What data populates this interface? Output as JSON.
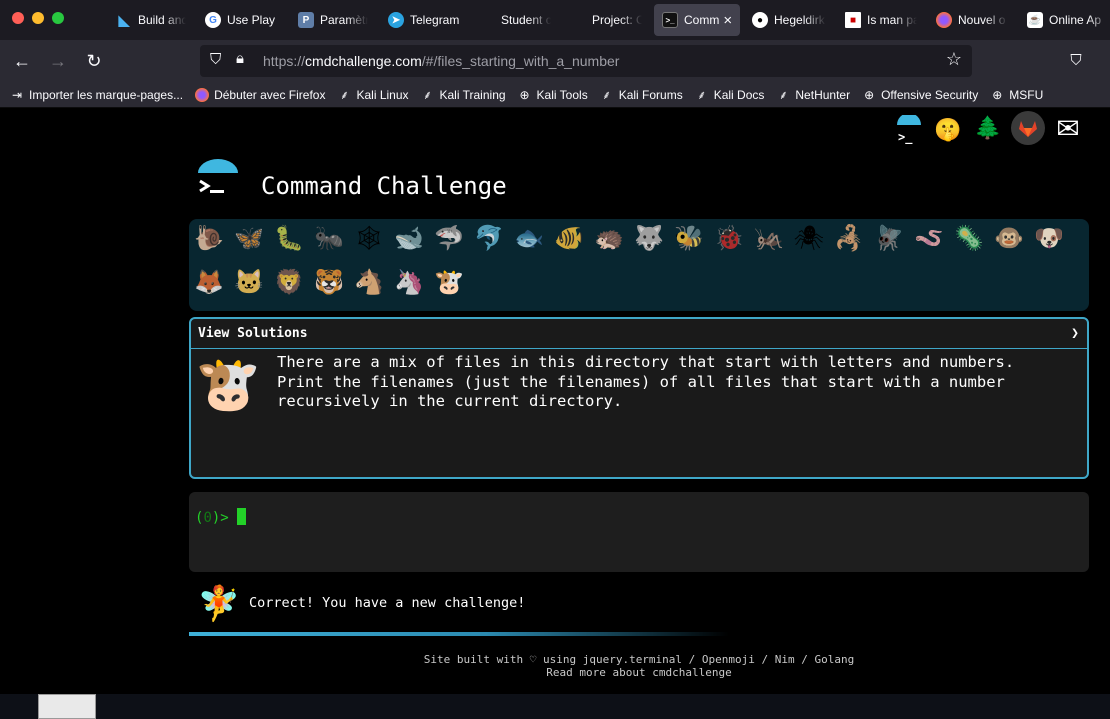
{
  "browser": {
    "tabs": [
      {
        "label": "Build and",
        "icon": "flutter-icon",
        "color": "#4ab2f1"
      },
      {
        "label": "Use Play",
        "icon": "google-icon",
        "color": "#ffffff"
      },
      {
        "label": "Paramètr",
        "icon": "settings-doc-icon",
        "color": "#7a9bd1"
      },
      {
        "label": "Telegram",
        "icon": "telegram-icon",
        "color": "#2aa3e0"
      },
      {
        "label": "Student c",
        "icon": "blank-icon",
        "color": "#1c1b22"
      },
      {
        "label": "Project: C",
        "icon": "blank-icon",
        "color": "#1c1b22"
      },
      {
        "label": "Comm",
        "icon": "terminal-icon",
        "color": "#111111"
      },
      {
        "label": "Hegeldirk",
        "icon": "github-icon",
        "color": "#ffffff"
      },
      {
        "label": "Is man pa",
        "icon": "doc-icon",
        "color": "#ffffff"
      },
      {
        "label": "Nouvel o",
        "icon": "firefox-icon",
        "color": "#ff7139"
      },
      {
        "label": "Online Ap",
        "icon": "java-icon",
        "color": "#ffffff"
      }
    ],
    "active_tab_close": "×",
    "url_prefix": "https://",
    "url_host": "cmdchallenge.com",
    "url_path": "/#/files_starting_with_a_number",
    "bookmarks": [
      {
        "label": "Importer les marque-pages...",
        "icon": "import-icon"
      },
      {
        "label": "Débuter avec Firefox",
        "icon": "firefox-icon"
      },
      {
        "label": "Kali Linux",
        "icon": "kali-icon"
      },
      {
        "label": "Kali Training",
        "icon": "kali-icon"
      },
      {
        "label": "Kali Tools",
        "icon": "globe-icon"
      },
      {
        "label": "Kali Forums",
        "icon": "kali-icon"
      },
      {
        "label": "Kali Docs",
        "icon": "kali-icon"
      },
      {
        "label": "NetHunter",
        "icon": "kali-icon"
      },
      {
        "label": "Offensive Security",
        "icon": "globe-icon"
      },
      {
        "label": "MSFU",
        "icon": "globe-icon"
      }
    ]
  },
  "site": {
    "title": "Command Challenge",
    "header_icons": [
      {
        "name": "cmd-logo-icon",
        "glyph": ">_"
      },
      {
        "name": "shushing-face-icon",
        "glyph": "🤫"
      },
      {
        "name": "evergreen-tree-icon",
        "glyph": "🌲"
      },
      {
        "name": "gitlab-icon",
        "glyph": "🦊"
      },
      {
        "name": "envelope-icon",
        "glyph": "✉"
      }
    ],
    "animals_row1": [
      "🐌",
      "🦋",
      "🐛",
      "🐜",
      "🕸",
      "🐋",
      "🦈",
      "🐬",
      "🐟",
      "🐠",
      "🦔",
      "🐺",
      "🐝",
      "🐞",
      "🦗",
      "🕷",
      "🦂",
      "🪰",
      "🪱",
      "🦠",
      "🐵",
      "🐶"
    ],
    "animals_row2": [
      "🦊",
      "🐱",
      "🦁",
      "🐯",
      "🐴",
      "🦄",
      "🐮"
    ],
    "solutions_label": "View Solutions",
    "solutions_chevron": "❯",
    "challenge_animal": "🐮",
    "challenge_text_1": "There are a mix of files in this directory that start with letters and numbers.",
    "challenge_text_2": "Print the filenames (just the filenames) of all files that start with a number",
    "challenge_text_3": "recursively in the current directory.",
    "prompt_open": "(",
    "prompt_count": "0",
    "prompt_close": ")>",
    "status_emoji": "🧚",
    "status_message": "Correct! You have a new challenge!",
    "footer_line1": "Site built with ♡ using jquery.terminal / Openmoji / Nim / Golang",
    "footer_line2": "Read more about cmdchallenge"
  },
  "colors": {
    "accent": "#3fa7c8",
    "prompt_green": "#23d128",
    "emoji_bar_bg": "#082630"
  }
}
